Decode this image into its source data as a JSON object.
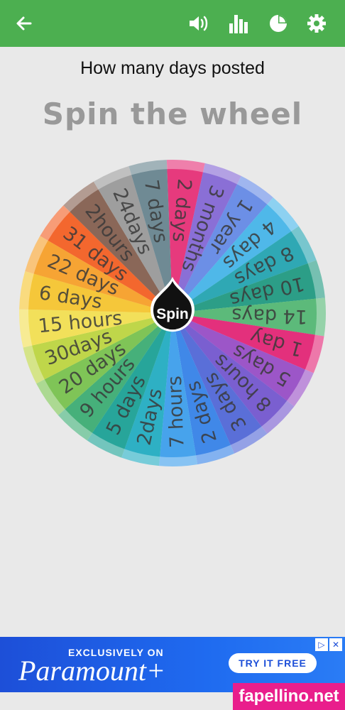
{
  "question": "How many days posted",
  "title": "Spin the wheel",
  "spin_label": "Spin",
  "toolbar": {
    "back_icon": "arrow-left-icon",
    "sound_icon": "volume-icon",
    "stats_icon": "bar-chart-icon",
    "pie_icon": "pie-chart-icon",
    "settings_icon": "gear-icon"
  },
  "wheel": {
    "segments": [
      {
        "label": "2 days",
        "color": "#e63a7d"
      },
      {
        "label": "3 months",
        "color": "#8a6fd6"
      },
      {
        "label": "1 year",
        "color": "#6c8fe6"
      },
      {
        "label": "4 days",
        "color": "#4fb8e9"
      },
      {
        "label": "8 days",
        "color": "#2fa8b4"
      },
      {
        "label": "10 days",
        "color": "#2c9e87"
      },
      {
        "label": "14 days",
        "color": "#5cba7a"
      },
      {
        "label": "1 day",
        "color": "#e3307c"
      },
      {
        "label": "5 days",
        "color": "#9c56c8"
      },
      {
        "label": "8 hours",
        "color": "#7a5fd0"
      },
      {
        "label": "3 days",
        "color": "#5a6fd8"
      },
      {
        "label": "2 days",
        "color": "#4088e8"
      },
      {
        "label": "7 hours",
        "color": "#47a3ec"
      },
      {
        "label": "2days",
        "color": "#2eb0c4"
      },
      {
        "label": "5 days",
        "color": "#27a59a"
      },
      {
        "label": "9 hours",
        "color": "#46b07a"
      },
      {
        "label": "20 days",
        "color": "#7fc457"
      },
      {
        "label": "30days",
        "color": "#bfd64a"
      },
      {
        "label": "15 hours",
        "color": "#f2e05a"
      },
      {
        "label": "6 days",
        "color": "#f5c73a"
      },
      {
        "label": "22 days",
        "color": "#f6a434"
      },
      {
        "label": "31 days",
        "color": "#f3672e"
      },
      {
        "label": "2hours",
        "color": "#8a6758"
      },
      {
        "label": "24days",
        "color": "#9e9e9e"
      },
      {
        "label": "7 days",
        "color": "#6f8a94"
      }
    ]
  },
  "ad": {
    "kicker": "EXCLUSIVELY ON",
    "brand": "Paramount+",
    "cta": "TRY IT FREE"
  },
  "watermark": "fapellino.net"
}
